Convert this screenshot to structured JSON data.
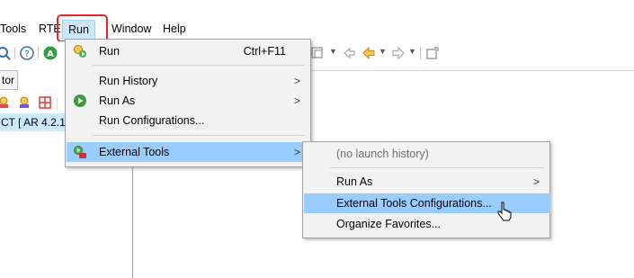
{
  "menubar": {
    "tools": "Tools",
    "rte": "RTE",
    "run": "Run",
    "window": "Window",
    "help": "Help"
  },
  "left_panel": {
    "view_tab": "tor",
    "tree_item": "CT [ AR 4.2.1 ]"
  },
  "run_menu": {
    "run": "Run",
    "run_shortcut": "Ctrl+F11",
    "run_history": "Run History",
    "run_as": "Run As",
    "run_configurations": "Run Configurations...",
    "external_tools": "External Tools",
    "submenu_arrow": ">"
  },
  "external_tools_menu": {
    "no_launch_history": "(no launch history)",
    "run_as": "Run As",
    "configurations": "External Tools Configurations...",
    "organize_favorites": "Organize Favorites...",
    "submenu_arrow": ">"
  },
  "colors": {
    "highlight": "#99ccff",
    "menu_bg": "#f2f2f2",
    "focus_ring": "#e8262a"
  }
}
